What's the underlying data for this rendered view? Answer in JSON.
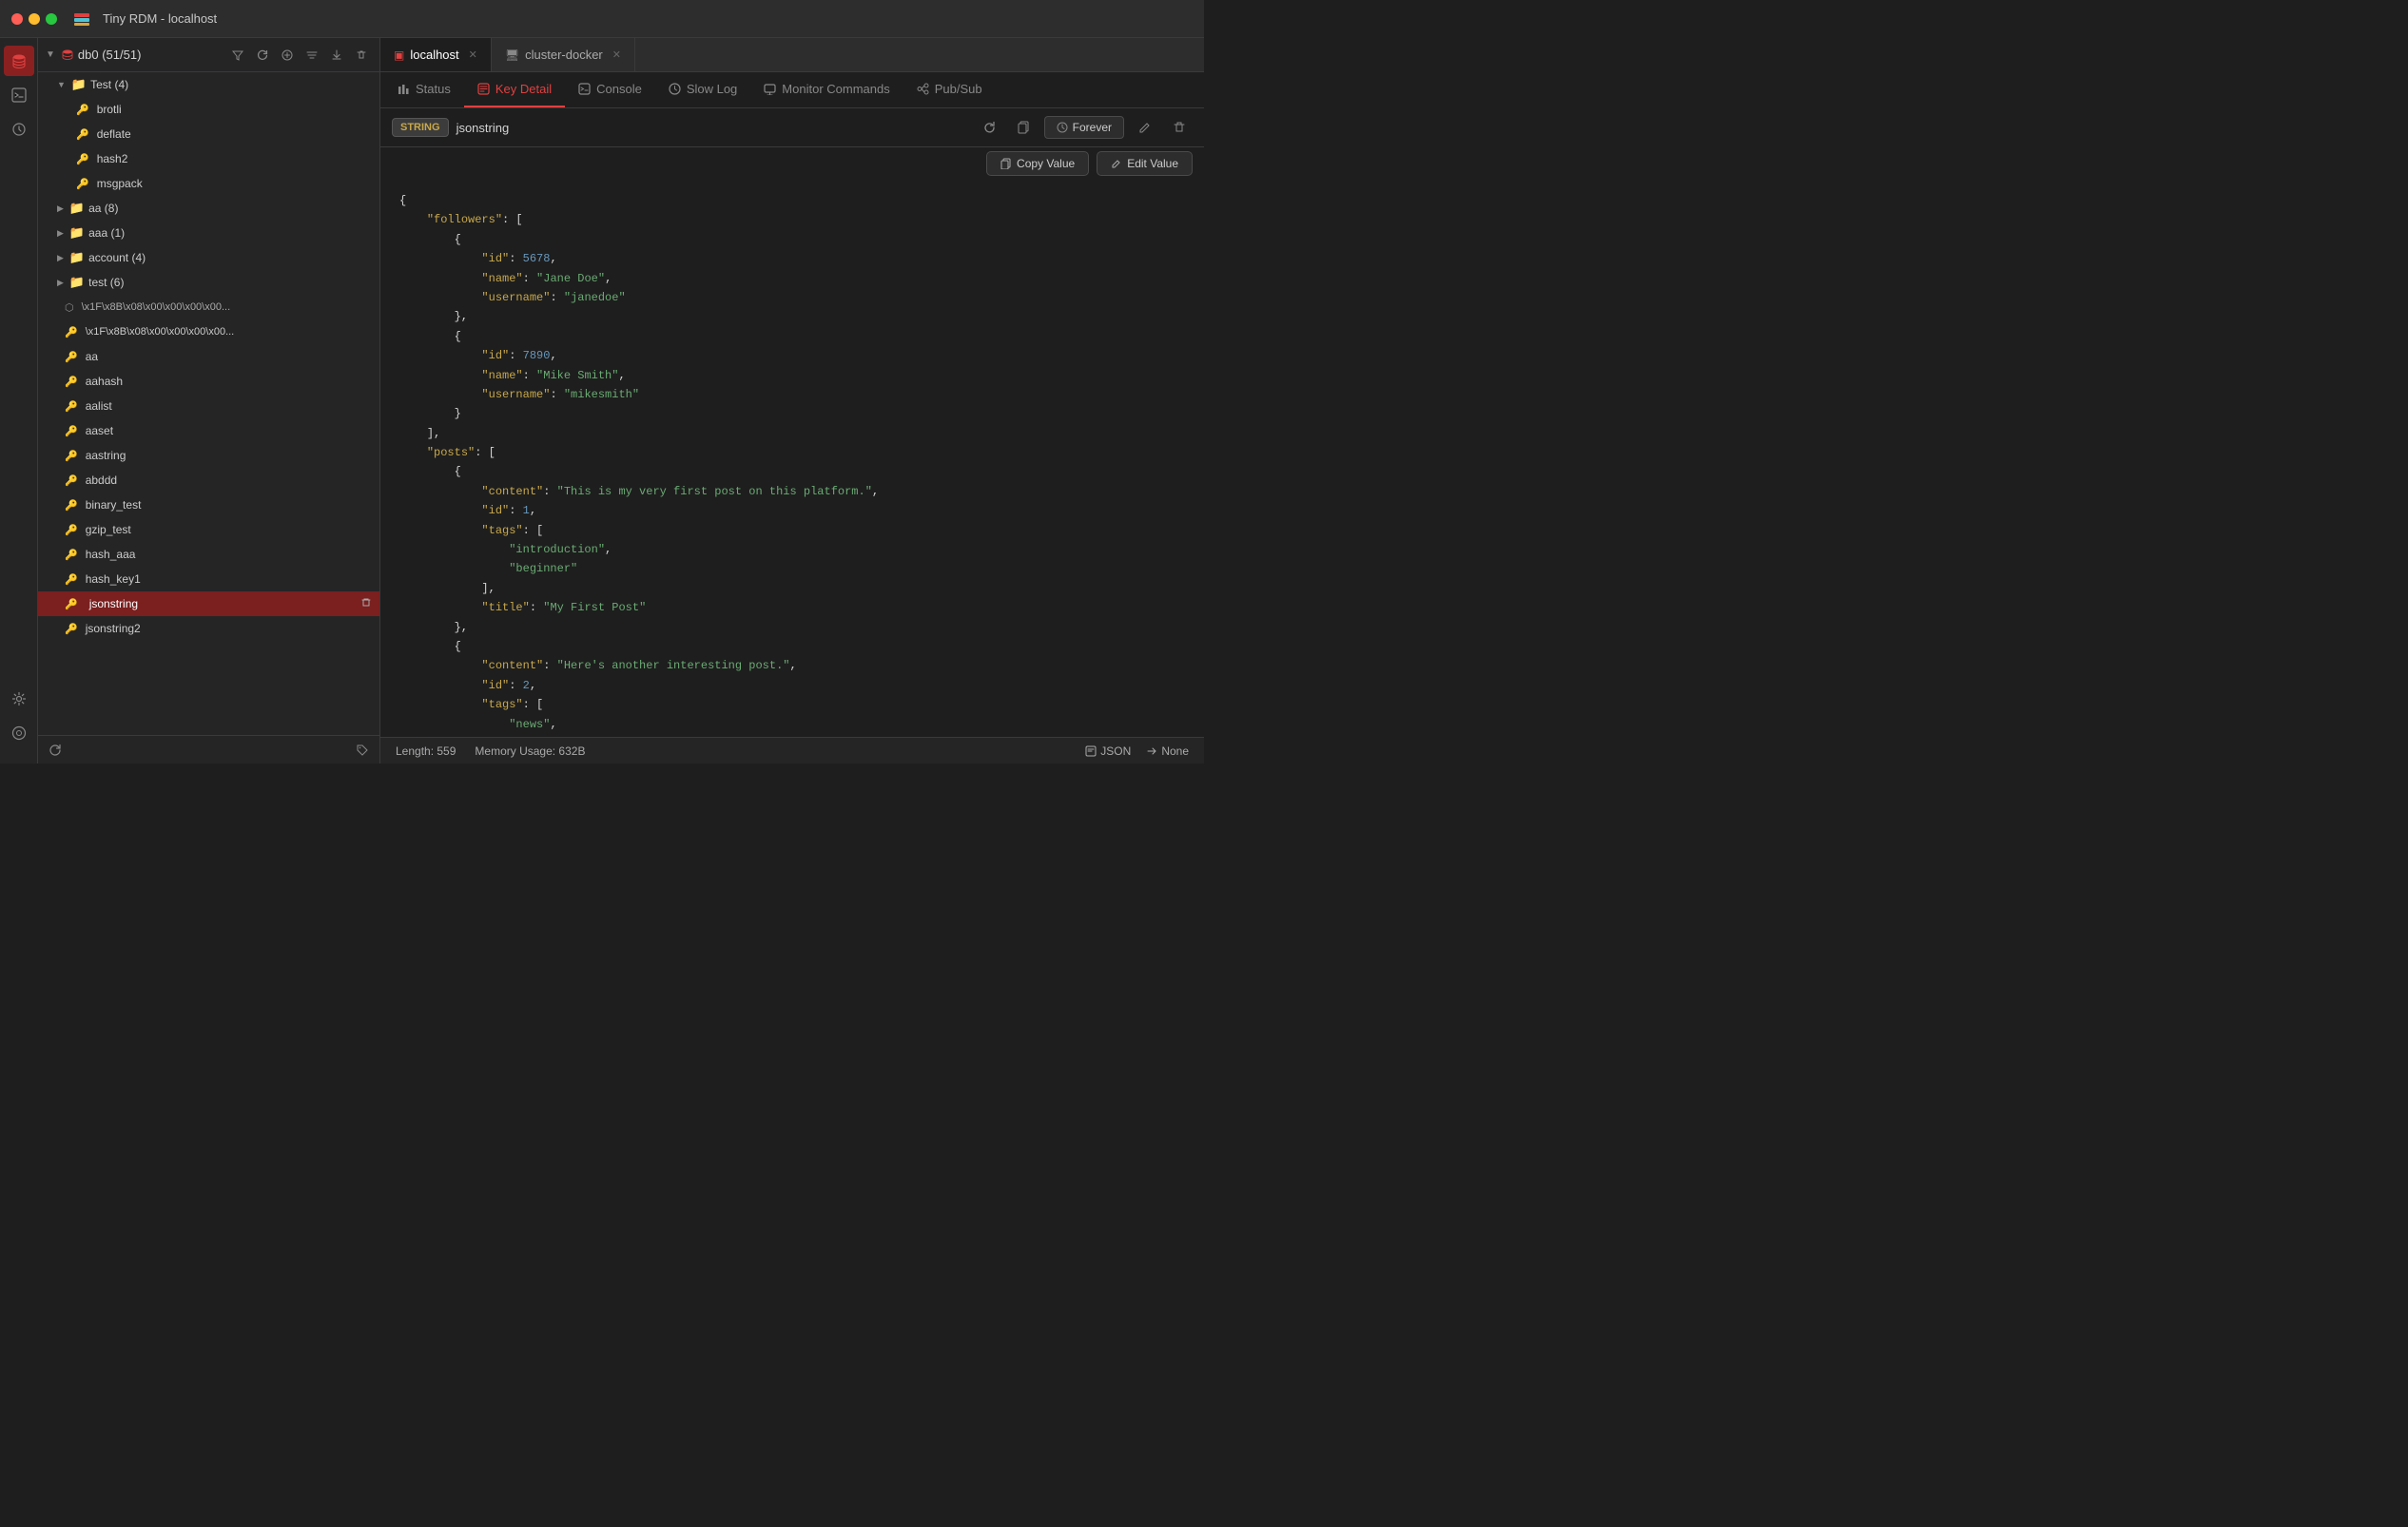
{
  "titlebar": {
    "title": "Tiny RDM - localhost"
  },
  "tabs": [
    {
      "id": "localhost",
      "label": "localhost",
      "active": true,
      "icon": "🟥"
    },
    {
      "id": "cluster-docker",
      "label": "cluster-docker",
      "active": false,
      "icon": "🖥"
    }
  ],
  "subtabs": [
    {
      "id": "status",
      "label": "Status",
      "icon": "📊",
      "active": false
    },
    {
      "id": "key-detail",
      "label": "Key Detail",
      "icon": "🔑",
      "active": true
    },
    {
      "id": "console",
      "label": "Console",
      "icon": "⌨",
      "active": false
    },
    {
      "id": "slow-log",
      "label": "Slow Log",
      "icon": "🕐",
      "active": false
    },
    {
      "id": "monitor-commands",
      "label": "Monitor Commands",
      "icon": "📡",
      "active": false
    },
    {
      "id": "pub-sub",
      "label": "Pub/Sub",
      "icon": "📢",
      "active": false
    }
  ],
  "tree": {
    "db_label": "db0 (51/51)",
    "items": [
      {
        "id": "test-folder",
        "label": "Test (4)",
        "type": "folder",
        "indent": 1,
        "expanded": true
      },
      {
        "id": "brotli",
        "label": "brotli",
        "type": "key",
        "indent": 2
      },
      {
        "id": "deflate",
        "label": "deflate",
        "type": "key",
        "indent": 2
      },
      {
        "id": "hash2",
        "label": "hash2",
        "type": "key",
        "indent": 2
      },
      {
        "id": "msgpack",
        "label": "msgpack",
        "type": "key",
        "indent": 2
      },
      {
        "id": "aa-folder",
        "label": "aa (8)",
        "type": "folder",
        "indent": 1,
        "expanded": false
      },
      {
        "id": "aaa-folder",
        "label": "aaa (1)",
        "type": "folder",
        "indent": 1,
        "expanded": false
      },
      {
        "id": "account-folder",
        "label": "account (4)",
        "type": "folder",
        "indent": 1,
        "expanded": false
      },
      {
        "id": "test2-folder",
        "label": "test (6)",
        "type": "folder",
        "indent": 1,
        "expanded": false
      },
      {
        "id": "binary1",
        "label": "\\x1F\\x8B\\x08\\x00\\x00\\x00\\x00...",
        "type": "binary",
        "indent": 1
      },
      {
        "id": "binary2",
        "label": "\\x1F\\x8B\\x08\\x00\\x00\\x00\\x00...",
        "type": "key",
        "indent": 1
      },
      {
        "id": "aa",
        "label": "aa",
        "type": "key",
        "indent": 1
      },
      {
        "id": "aahash",
        "label": "aahash",
        "type": "key",
        "indent": 1
      },
      {
        "id": "aalist",
        "label": "aalist",
        "type": "key",
        "indent": 1
      },
      {
        "id": "aaset",
        "label": "aaset",
        "type": "key",
        "indent": 1
      },
      {
        "id": "aastring",
        "label": "aastring",
        "type": "key",
        "indent": 1
      },
      {
        "id": "abddd",
        "label": "abddd",
        "type": "key",
        "indent": 1
      },
      {
        "id": "binary_test",
        "label": "binary_test",
        "type": "key",
        "indent": 1
      },
      {
        "id": "gzip_test",
        "label": "gzip_test",
        "type": "key",
        "indent": 1
      },
      {
        "id": "hash_aaa",
        "label": "hash_aaa",
        "type": "key",
        "indent": 1
      },
      {
        "id": "hash_key1",
        "label": "hash_key1",
        "type": "key",
        "indent": 1
      },
      {
        "id": "jsonstring",
        "label": "jsonstring",
        "type": "key",
        "indent": 1,
        "selected": true
      },
      {
        "id": "jsonstring2",
        "label": "jsonstring2",
        "type": "key",
        "indent": 1
      }
    ]
  },
  "key_detail": {
    "type_badge": "STRING",
    "key_name": "jsonstring",
    "ttl_label": "Forever",
    "copy_value_label": "Copy Value",
    "edit_value_label": "Edit Value"
  },
  "json_content": "{\n    \"followers\": [\n        {\n            \"id\": 5678,\n            \"name\": \"Jane Doe\",\n            \"username\": \"janedoe\"\n        },\n        {\n            \"id\": 7890,\n            \"name\": \"Mike Smith\",\n            \"username\": \"mikesmith\"\n        }\n    ],\n    \"posts\": [\n        {\n            \"content\": \"This is my very first post on this platform.\",\n            \"id\": 1,\n            \"tags\": [\n                \"introduction\",\n                \"beginner\"\n            ],\n            \"title\": \"My First Post\"\n        },\n        {\n            \"content\": \"Here's another interesting post.\",\n            \"id\": 2,\n            \"tags\": [\n                \"news\",",
  "status_bar": {
    "length": "Length: 559",
    "memory": "Memory Usage: 632B",
    "format": "JSON",
    "decode": "None"
  },
  "sidebar": {
    "icons": [
      {
        "id": "database",
        "label": "🗄",
        "active": true
      },
      {
        "id": "terminal",
        "label": "⬜"
      },
      {
        "id": "history",
        "label": "⟳"
      }
    ],
    "bottom_icons": [
      {
        "id": "settings",
        "label": "⚙"
      },
      {
        "id": "github",
        "label": "◉"
      }
    ]
  }
}
